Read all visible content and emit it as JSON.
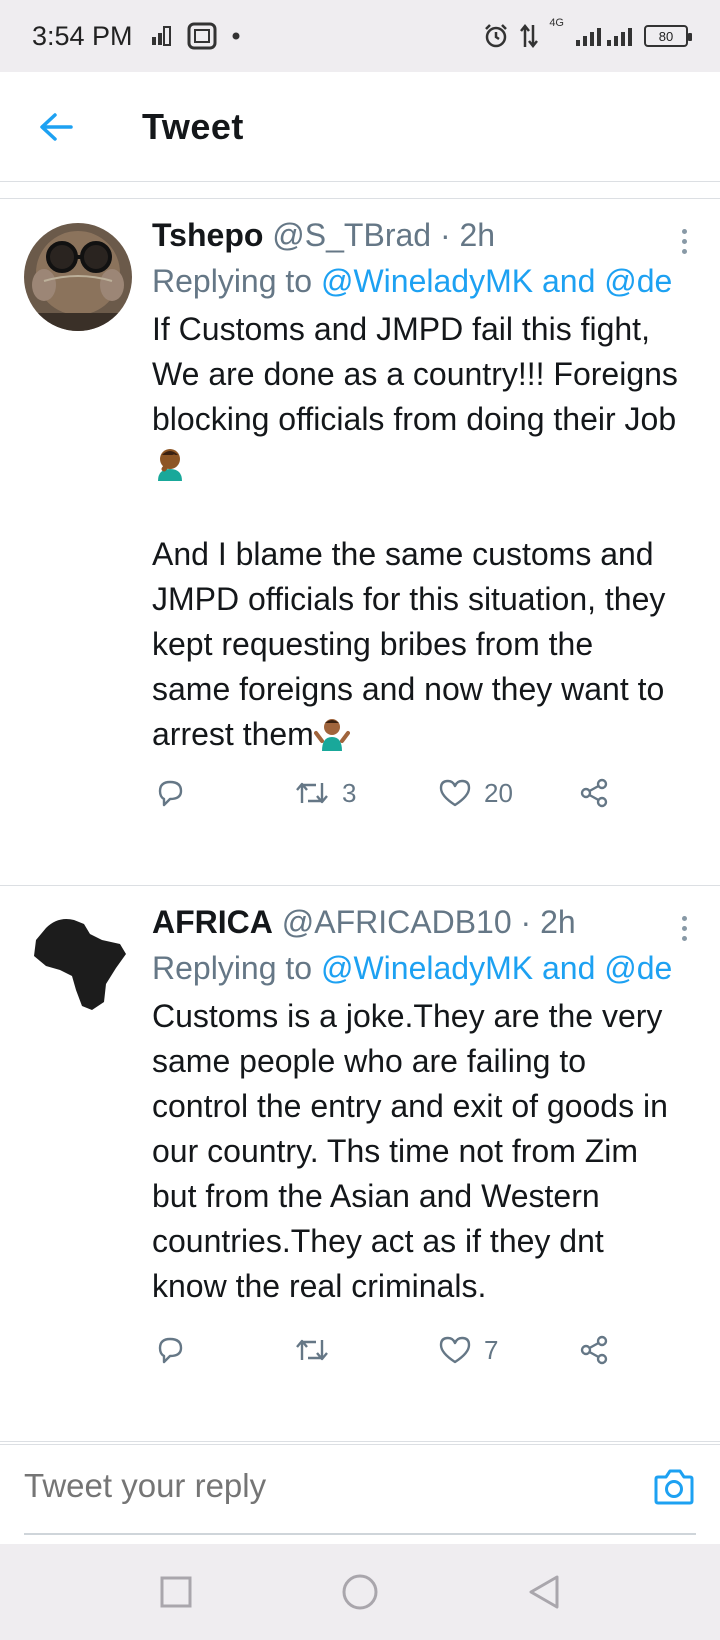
{
  "status_bar": {
    "time": "3:54 PM",
    "network": "4G",
    "battery": "80"
  },
  "header": {
    "title": "Tweet"
  },
  "tweets": [
    {
      "name": "Tshepo",
      "handle": "@S_TBrad",
      "sep": "·",
      "time": "2h",
      "replying_prefix": "Replying to ",
      "replying_to": "@WineladyMK and @de",
      "text_part1": "If Customs and JMPD fail this fight, We are done as a country!!! Foreigns blocking officials from doing their Job",
      "text_part2": "\n\nAnd I blame the same customs and JMPD officials for this situation, they kept requesting bribes from the same foreigns and now they want to arrest them",
      "retweets": "3",
      "likes": "20"
    },
    {
      "name": "AFRICA",
      "handle": "@AFRICADB10",
      "sep": "·",
      "time": "2h",
      "replying_prefix": "Replying to ",
      "replying_to": "@WineladyMK and @de",
      "text_part1": "Customs is a joke.They are the very same people who are failing to control the entry and exit of goods in our country. Ths time not from Zim but from the Asian and Western countries.They act as if they dnt know the real criminals.",
      "retweets": "",
      "likes": "7"
    }
  ],
  "reply_bar": {
    "placeholder": "Tweet your reply"
  },
  "colors": {
    "accent": "#1da1f2",
    "muted": "#657786",
    "text": "#14171a"
  },
  "icons": [
    "back-arrow-icon",
    "more-icon",
    "reply-icon",
    "retweet-icon",
    "like-icon",
    "share-icon",
    "camera-icon",
    "alarm-icon",
    "recents-icon",
    "home-icon",
    "back-nav-icon"
  ]
}
